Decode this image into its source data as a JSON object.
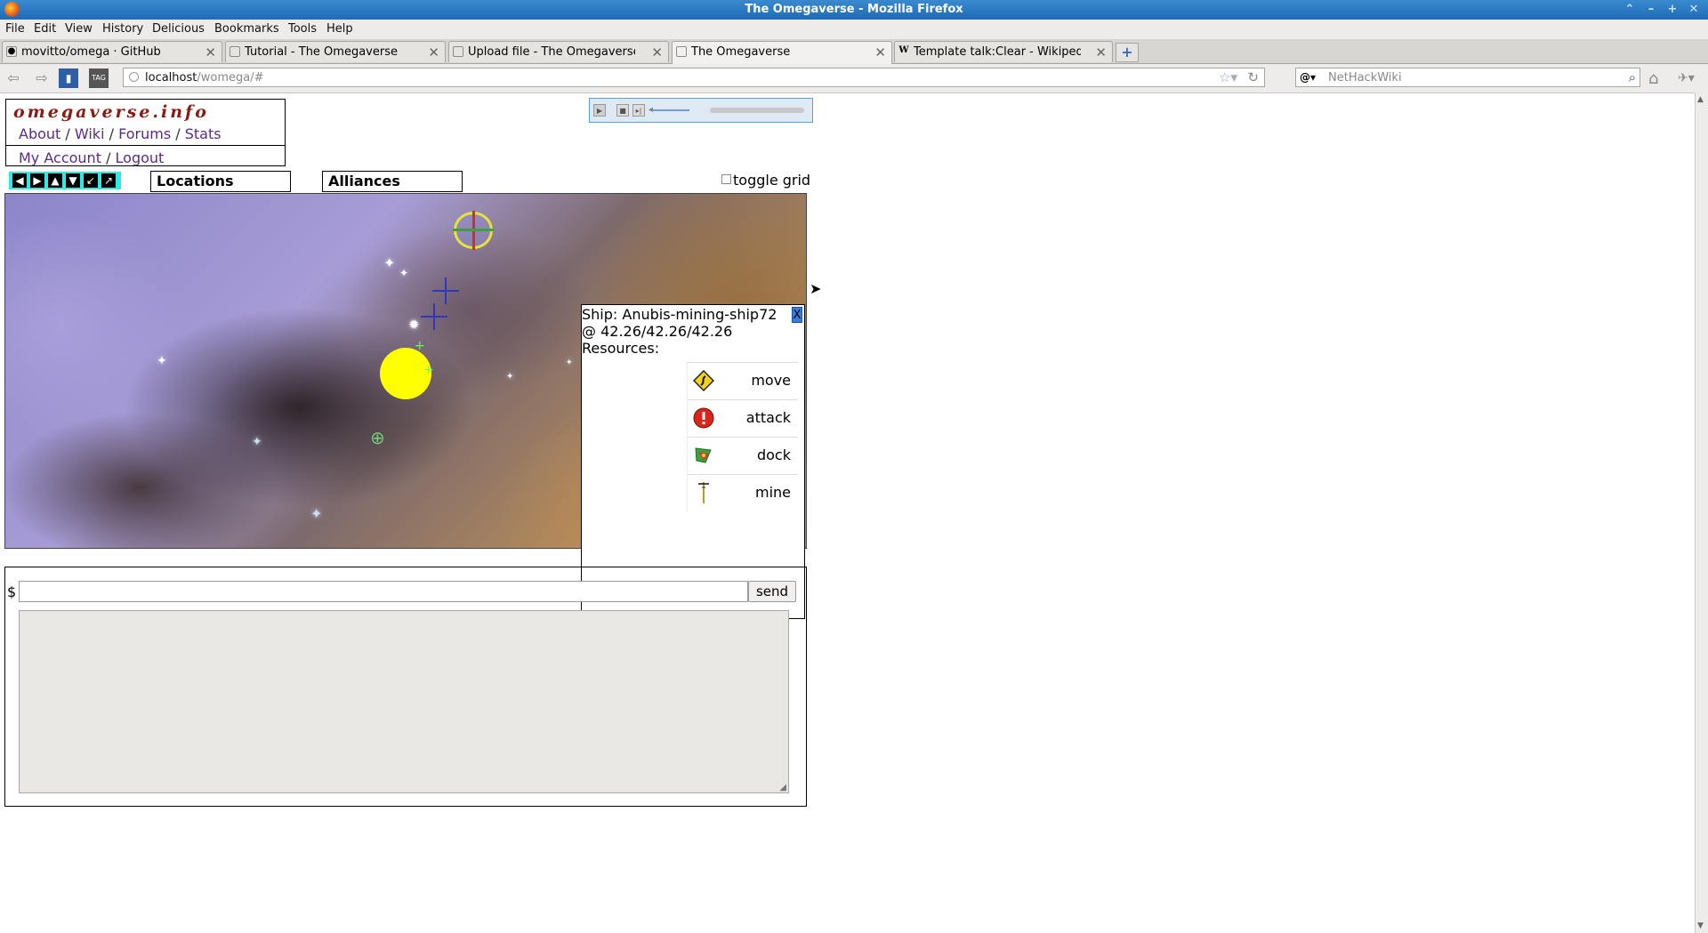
{
  "window": {
    "title": "The Omegaverse - Mozilla Firefox"
  },
  "menu": [
    "File",
    "Edit",
    "View",
    "History",
    "Delicious",
    "Bookmarks",
    "Tools",
    "Help"
  ],
  "tabs": [
    {
      "label": "movitto/omega · GitHub"
    },
    {
      "label": "Tutorial - The Omegaverse"
    },
    {
      "label": "Upload file - The Omegaverse"
    },
    {
      "label": "The Omegaverse"
    },
    {
      "label": "Template talk:Clear - Wikipedi..."
    }
  ],
  "toolbar": {
    "url_host": "localhost",
    "url_path": "/womega/#",
    "search_placeholder": "NetHackWiki"
  },
  "site": {
    "brand": "omegaverse.info",
    "nav": [
      "About",
      "Wiki",
      "Forums",
      "Stats"
    ],
    "account": [
      "My Account",
      "Logout"
    ],
    "sep": "/"
  },
  "controls": {
    "arrows": [
      "◀",
      "▶",
      "▲",
      "▼",
      "↙",
      "↗"
    ],
    "tab_locations": "Locations",
    "tab_alliances": "Alliances",
    "toggle_grid": "toggle grid"
  },
  "ship": {
    "title": "Ship: Anubis-mining-ship72",
    "location": "@ 42.26/42.26/42.26",
    "resources_label": "Resources:",
    "close_label": "X",
    "actions": [
      {
        "label": "move",
        "icon": "move-sign-icon"
      },
      {
        "label": "attack",
        "icon": "attack-alert-icon"
      },
      {
        "label": "dock",
        "icon": "dock-icon"
      },
      {
        "label": "mine",
        "icon": "mine-icon"
      }
    ]
  },
  "console": {
    "prompt": "$",
    "input_value": "",
    "send_label": "send"
  },
  "colors": {
    "titlebar": "#1f6bb5",
    "brand": "#8b1a12",
    "link": "#5b2a8a",
    "nav_arrows_bg": "#2fe8e8",
    "sun": "#ffff00"
  }
}
